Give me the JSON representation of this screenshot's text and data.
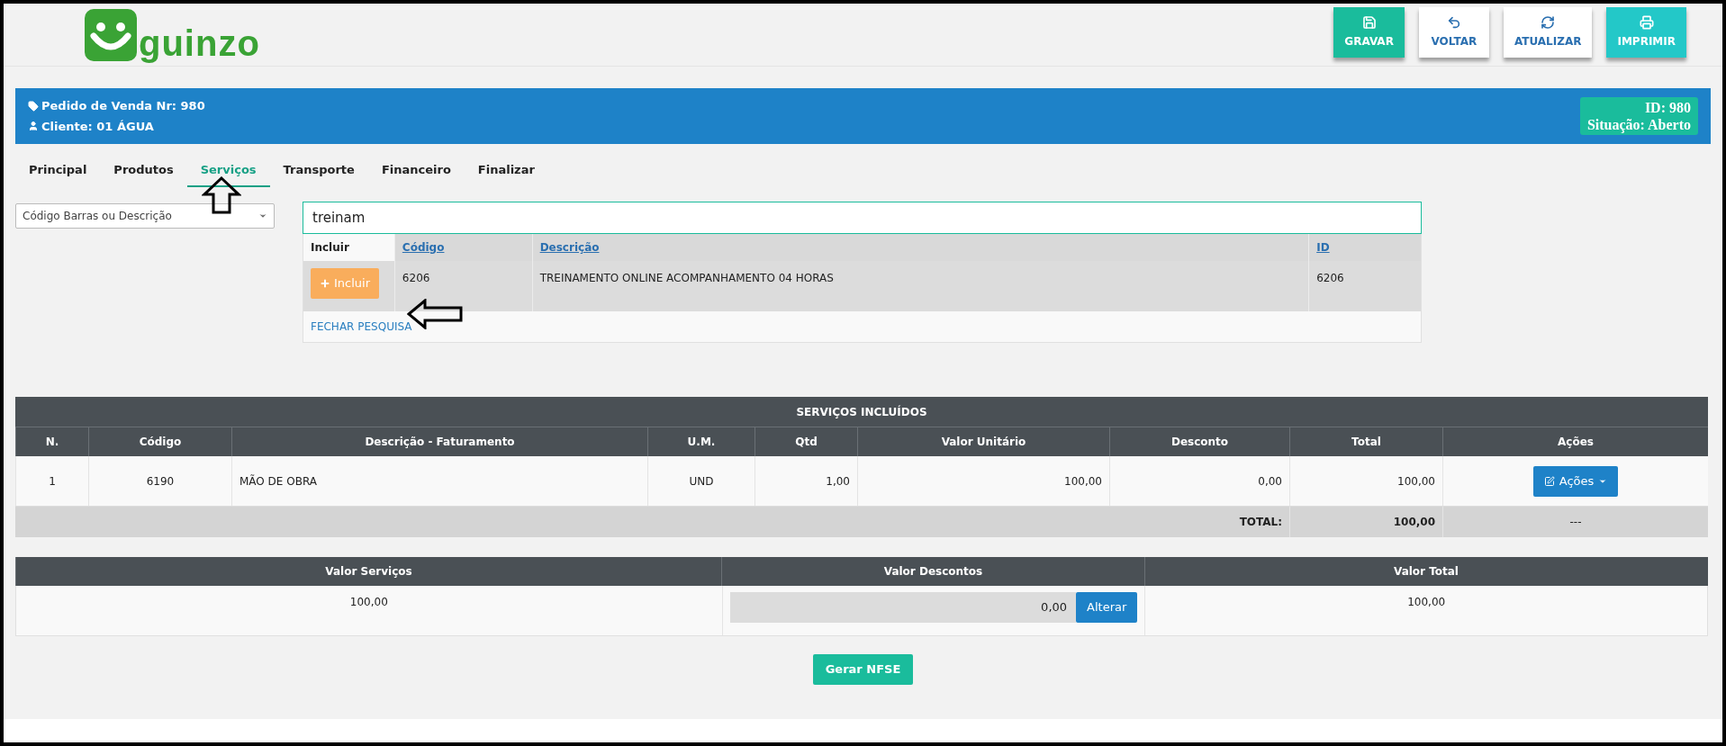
{
  "logo": {
    "text": "guinzo"
  },
  "toolbar": [
    {
      "label": "GRAVAR",
      "kind": "save"
    },
    {
      "label": "VOLTAR",
      "kind": "back"
    },
    {
      "label": "ATUALIZAR",
      "kind": "refresh"
    },
    {
      "label": "IMPRIMIR",
      "kind": "print"
    }
  ],
  "order_bar": {
    "order": "Pedido de Venda Nr: 980",
    "client": "Cliente: 01 ÁGUA",
    "id": "ID: 980",
    "status": "Situação: Aberto"
  },
  "tabs": [
    {
      "label": "Principal",
      "selected": false
    },
    {
      "label": "Produtos",
      "selected": false
    },
    {
      "label": "Serviços",
      "selected": true
    },
    {
      "label": "Transporte",
      "selected": false
    },
    {
      "label": "Financeiro",
      "selected": false
    },
    {
      "label": "Finalizar",
      "selected": false
    }
  ],
  "search": {
    "filter": "Código Barras ou Descrição",
    "value": "treinam"
  },
  "results": {
    "columns": [
      "Incluir",
      "Código",
      "Descrição",
      "ID"
    ],
    "rows": [
      {
        "cells": [
          "Incluir",
          "6206",
          "TREINAMENTO ONLINE ACOMPANHAMENTO 04 HORAS",
          "6206"
        ]
      }
    ],
    "close_link": "FECHAR PESQUISA"
  },
  "services": {
    "title": "SERVIÇOS INCLUÍDOS",
    "columns": [
      "N.",
      "Código",
      "Descrição - Faturamento",
      "U.M.",
      "Qtd",
      "Valor Unitário",
      "Desconto",
      "Total",
      "Ações"
    ],
    "rows": [
      {
        "cells": [
          "1",
          "6190",
          "MÃO DE OBRA",
          "UND",
          "1,00",
          "100,00",
          "0,00",
          "100,00"
        ],
        "action": "Ações"
      }
    ],
    "total": {
      "label": "TOTAL:",
      "value": "100,00",
      "actions": "---"
    }
  },
  "summary": {
    "columns": [
      "Valor Serviços",
      "Valor Descontos",
      "Valor Total"
    ],
    "services_value": "100,00",
    "discount_value": "0,00",
    "discount_button": "Alterar",
    "total_value": "100,00"
  },
  "generate_button": "Gerar NFSE"
}
